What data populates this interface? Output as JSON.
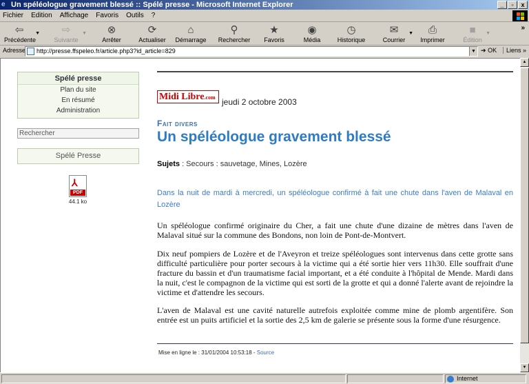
{
  "window": {
    "title": "Un spéléologue gravement blessé :: Spélé presse - Microsoft Internet Explorer",
    "controls": [
      "_",
      "▫",
      "x"
    ]
  },
  "menu": [
    "Fichier",
    "Edition",
    "Affichage",
    "Favoris",
    "Outils",
    "?"
  ],
  "toolbar": {
    "back": "Précédente",
    "forward": "Suivante",
    "stop": "Arrêter",
    "refresh": "Actualiser",
    "home": "Démarrage",
    "search": "Rechercher",
    "favorites": "Favoris",
    "media": "Média",
    "history": "Historique",
    "mail": "Courrier",
    "print": "Imprimer",
    "edit": "Édition",
    "more": "»"
  },
  "address": {
    "label": "Adresse",
    "url": "http://presse.ffspeleo.fr/article.php3?id_article=829",
    "go": "OK",
    "links": "Liens »"
  },
  "sidebar": {
    "site_title": "Spélé presse",
    "links": [
      "Plan du site",
      "En résumé",
      "Administration"
    ],
    "search_placeholder": "Rechercher",
    "box2": "Spélé Presse",
    "pdf_label": "PDF",
    "pdf_size": "44.1 ko"
  },
  "article": {
    "source_logo": "Midi Libre",
    "source_logo_suffix": ".com",
    "date": "jeudi 2 octobre 2003",
    "rubrique": "Fait divers",
    "title": "Un spéléologue gravement blessé",
    "sujets_label": "Sujets",
    "sujets_value": " : Secours : sauvetage, Mines, Lozère",
    "chapo": "Dans la nuit de mardi à mercredi, un spéléologue confirmé à fait une chute dans l'aven de Malaval en Lozère",
    "paragraphs": [
      "Un spéléologue confirmé originaire du Cher, a fait une chute d'une dizaine de mètres dans l'aven de Malaval situé sur la commune des Bondons, non loin de Pont-de-Montvert.",
      "Dix neuf pompiers de Lozère et de l'Aveyron et treize spéléologues sont intervenus dans cette grotte sans difficulté particulière pour porter secours à la victime qui a été sortie hier vers 11h30. Elle souffrait d'une fracture du bassin et d'un traumatisme facial important, et a été conduite à l'hôpital de Mende. Mardi dans la nuit, c'est le compagnon de la victime qui est sorti de la grotte et qui a donné l'alerte avant de rejoindre la victime et d'attendre les secours.",
      "L'aven de Malaval est une cavité naturelle autrefois exploitée comme mine de plomb argentifère. Son entrée est un puits artificiel et la sortie des 2,5 km de galerie se présente sous la forme d'une résurgence."
    ],
    "footer_text": "Mise en ligne le : 31/01/2004 10:53:18 - ",
    "footer_link": "Source"
  },
  "status": {
    "zone": "Internet"
  },
  "colors": {
    "titlebar": "#0a246a",
    "link_blue": "#2e7bc4",
    "sidebar_bg": "#f4f8ee",
    "midilibre_red": "#cc0000"
  }
}
